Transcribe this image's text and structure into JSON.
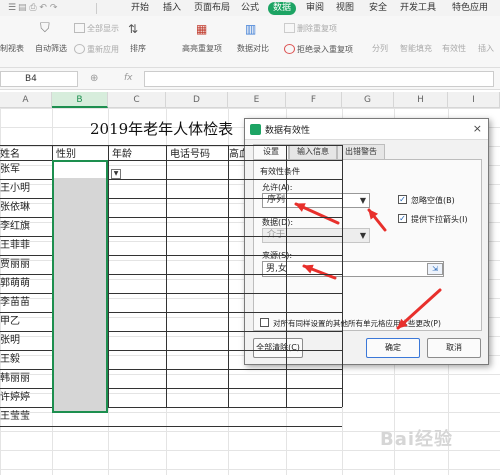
{
  "ribbon_tabs": [
    "开始",
    "插入",
    "页面布局",
    "公式",
    "数据",
    "审阅",
    "视图",
    "安全",
    "开发工具",
    "特色应用"
  ],
  "active_tab": "数据",
  "ribbon": {
    "filter_all": "全部显示",
    "reapply": "重新应用",
    "auto_filter": "自动筛选",
    "sort": "排序",
    "highlight_dup": "高亮重复项",
    "data_compare": "数据对比",
    "remove_dup": "删除重复项",
    "reject_dup": "拒绝录入重复项",
    "split": "分列",
    "smart_fill": "智能填充",
    "validity": "有效性",
    "insert": "插入",
    "left_partial": "制视表"
  },
  "formula_bar": {
    "cell_ref": "B4",
    "fx": "fx"
  },
  "sheet": {
    "columns": [
      "A",
      "B",
      "C",
      "D",
      "E",
      "F",
      "G",
      "H",
      "I"
    ],
    "selected_column": "B",
    "title": "2019年老年人体检表",
    "headers": [
      "姓名",
      "性别",
      "年龄",
      "电话号码",
      "高血"
    ],
    "names": [
      "张军",
      "王小明",
      "张依琳",
      "李红旗",
      "王菲菲",
      "贾丽丽",
      "郭萌萌",
      "李苗苗",
      "甲乙",
      "张明",
      "王毅",
      "韩丽丽",
      "许婷婷",
      "王莹莹"
    ]
  },
  "dialog": {
    "title": "数据有效性",
    "close": "×",
    "tabs": [
      "设置",
      "输入信息",
      "出错警告"
    ],
    "section": "有效性条件",
    "allow_label": "允许(A):",
    "allow_value": "序列",
    "ignore_blank": "忽略空值(B)",
    "dropdown": "提供下拉箭头(I)",
    "data_label": "数据(D):",
    "data_value": "介于",
    "source_label": "来源(S):",
    "source_value": "男,女",
    "apply_all": "对所有同样设置的其他所有单元格应用这些更改(P)",
    "clear_all": "全部清除(C)",
    "ok": "确定",
    "cancel": "取消"
  },
  "colors": {
    "accent": "#1da464",
    "arrow": "#e8302c",
    "selection": "#1d8f4f"
  },
  "watermark": "Bai经验"
}
